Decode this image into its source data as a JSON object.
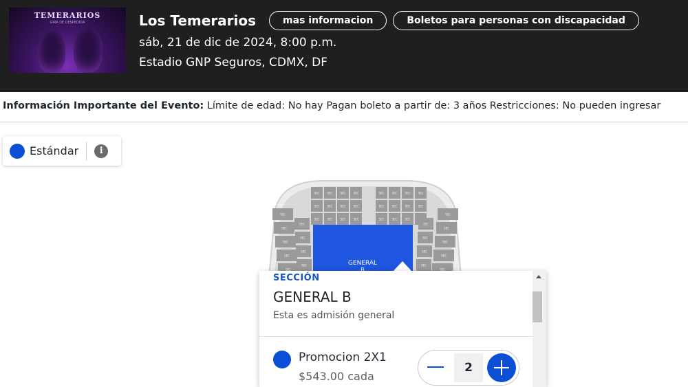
{
  "header": {
    "poster_title": "TEMERARIOS",
    "poster_subtitle": "GIRA DE DESPEDIDA",
    "event_title": "Los Temerarios",
    "more_info_label": "mas informacion",
    "accessibility_label": "Boletos para personas con discapacidad",
    "date": "sáb, 21 de dic de 2024, 8:00 p.m.",
    "venue": "Estadio GNP Seguros, CDMX, DF"
  },
  "info_bar": {
    "label": "Información Importante del Evento:",
    "text": "Límite de edad: No hay Pagan boleto a partir de: 3 años Restricciones: No pueden ingresar"
  },
  "legend": {
    "label": "Estándar",
    "color": "#0b4fd6",
    "info_icon": "i"
  },
  "map": {
    "section_label": "GENERAL",
    "section_sublabel": "B",
    "seat_label": "SEC",
    "field_color": "#1f56e0",
    "seat_color": "#9a9a9a"
  },
  "popup": {
    "section_caption": "SECCIÓN",
    "section_name": "GENERAL B",
    "description": "Esta es admisión general",
    "ticket": {
      "name": "Promocion 2X1",
      "price": "$543.00 cada",
      "quantity": "2"
    }
  }
}
